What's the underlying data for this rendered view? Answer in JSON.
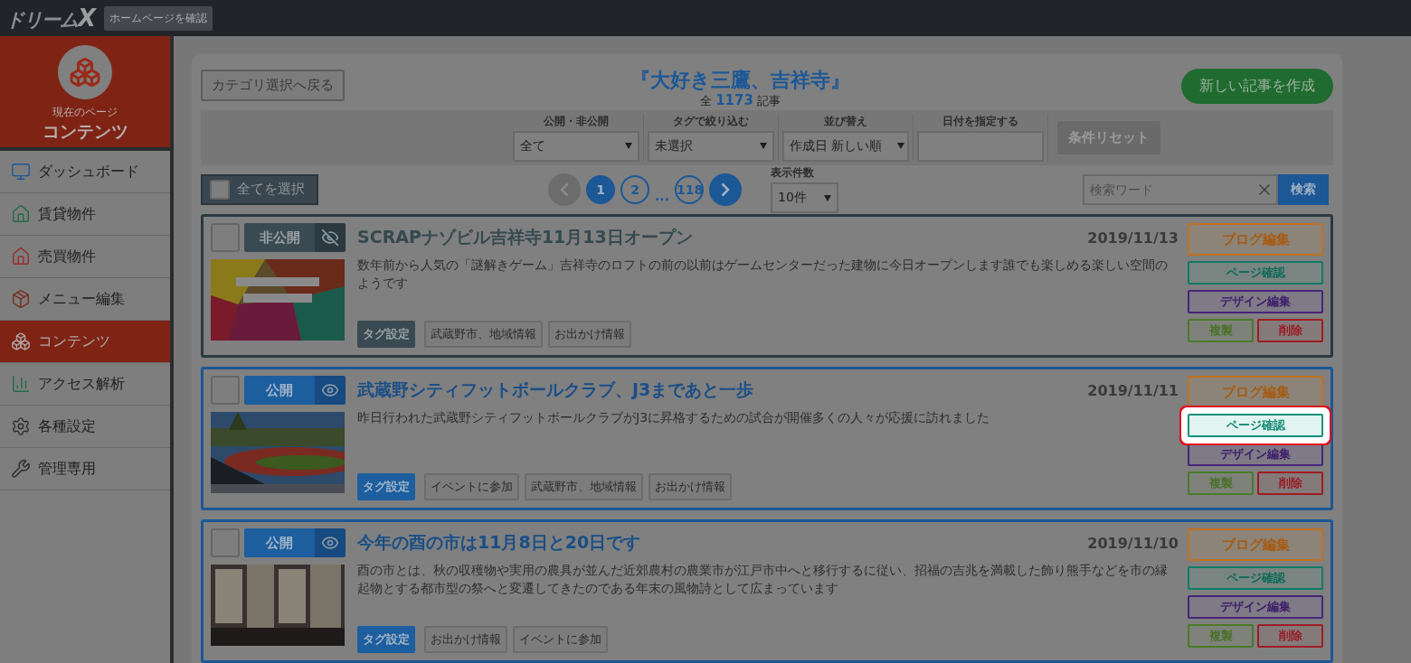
{
  "topbar": {
    "logo": "ドリーム",
    "logo_mark": "X",
    "home_button": "ホームページを確認"
  },
  "sidebar": {
    "current_label": "現在のページ",
    "current_page": "コンテンツ",
    "items": [
      {
        "label": "ダッシュボード",
        "selected": false
      },
      {
        "label": "賃貸物件",
        "selected": false
      },
      {
        "label": "売買物件",
        "selected": false
      },
      {
        "label": "メニュー編集",
        "selected": false
      },
      {
        "label": "コンテンツ",
        "selected": true
      },
      {
        "label": "アクセス解析",
        "selected": false
      },
      {
        "label": "各種設定",
        "selected": false
      },
      {
        "label": "管理専用",
        "selected": false
      }
    ]
  },
  "header": {
    "back_button": "カテゴリ選択へ戻る",
    "title": "『大好き三鷹、吉祥寺』",
    "count_prefix": "全",
    "count": "1173",
    "count_suffix": "記事",
    "new_button": "新しい記事を作成"
  },
  "filters": [
    {
      "kind": "select",
      "label": "公開・非公開",
      "value": "全て"
    },
    {
      "kind": "select",
      "label": "タグで絞り込む",
      "value": "未選択"
    },
    {
      "kind": "select",
      "label": "並び替え",
      "value": "作成日 新しい順"
    },
    {
      "kind": "date",
      "label": "日付を指定する"
    }
  ],
  "reset_button": "条件リセット",
  "select_all": {
    "label": "全てを選択",
    "checked": false
  },
  "pagination": {
    "prev_disabled": true,
    "pages": [
      {
        "label": "1",
        "selected": true
      },
      {
        "label": "2",
        "selected": false
      }
    ],
    "ellipsis": "...",
    "last": "118"
  },
  "per_page": {
    "label": "表示件数",
    "value": "10件"
  },
  "search": {
    "placeholder": "検索ワード",
    "button": "検索"
  },
  "articles": [
    {
      "checked": false,
      "status": {
        "kind": "private",
        "label": "非公開"
      },
      "title": "SCRAPナゾビル吉祥寺11月13日オープン",
      "date": "2019/11/13",
      "excerpt": "数年前から人気の「謎解きゲーム」吉祥寺のロフトの前の以前はゲームセンターだった建物に今日オープンします誰でも楽しめる楽しい空間のようです",
      "tag_button": "タグ設定",
      "tags": [
        "武蔵野市、地域情報",
        "お出かけ情報"
      ],
      "picture": {
        "kind": "picture"
      },
      "actions": [
        {
          "kind": "blog",
          "label": "ブログ編集",
          "highlighted": false
        },
        {
          "kind": "page",
          "label": "ページ確認",
          "highlighted": false
        },
        {
          "kind": "design",
          "label": "デザイン編集",
          "highlighted": false
        },
        {
          "kind": "copy",
          "label": "複製",
          "highlighted": false
        },
        {
          "kind": "delete",
          "label": "削除",
          "highlighted": false
        }
      ]
    },
    {
      "checked": false,
      "status": {
        "kind": "public",
        "label": "公開"
      },
      "title": "武蔵野シティフットボールクラブ、J3まであと一歩",
      "date": "2019/11/11",
      "excerpt": "昨日行われた武蔵野シティフットボールクラブがJ3に昇格するための試合が開催多くの人々が応援に訪れました",
      "tag_button": "タグ設定",
      "tags": [
        "イベントに参加",
        "武蔵野市、地域情報",
        "お出かけ情報"
      ],
      "picture": {
        "kind": "picture"
      },
      "actions": [
        {
          "kind": "blog",
          "label": "ブログ編集",
          "highlighted": false
        },
        {
          "kind": "page",
          "label": "ページ確認",
          "highlighted": true
        },
        {
          "kind": "design",
          "label": "デザイン編集",
          "highlighted": false
        },
        {
          "kind": "copy",
          "label": "複製",
          "highlighted": false
        },
        {
          "kind": "delete",
          "label": "削除",
          "highlighted": false
        }
      ]
    },
    {
      "checked": false,
      "status": {
        "kind": "public",
        "label": "公開"
      },
      "title": "今年の酉の市は11月8日と20日です",
      "date": "2019/11/10",
      "excerpt": "酉の市とは、秋の収穫物や実用の農具が並んだ近郊農村の農業市が江戸市中へと移行するに従い、招福の吉兆を満載した飾り熊手などを市の縁起物とする都市型の祭へと変遷してきたのである年末の風物詩として広まっています",
      "tag_button": "タグ設定",
      "tags": [
        "お出かけ情報",
        "イベントに参加"
      ],
      "picture": {
        "kind": "picture"
      },
      "actions": [
        {
          "kind": "blog",
          "label": "ブログ編集",
          "highlighted": false
        },
        {
          "kind": "page",
          "label": "ページ確認",
          "highlighted": false
        },
        {
          "kind": "design",
          "label": "デザイン編集",
          "highlighted": false
        },
        {
          "kind": "copy",
          "label": "複製",
          "highlighted": false
        },
        {
          "kind": "delete",
          "label": "削除",
          "highlighted": false
        }
      ]
    }
  ]
}
